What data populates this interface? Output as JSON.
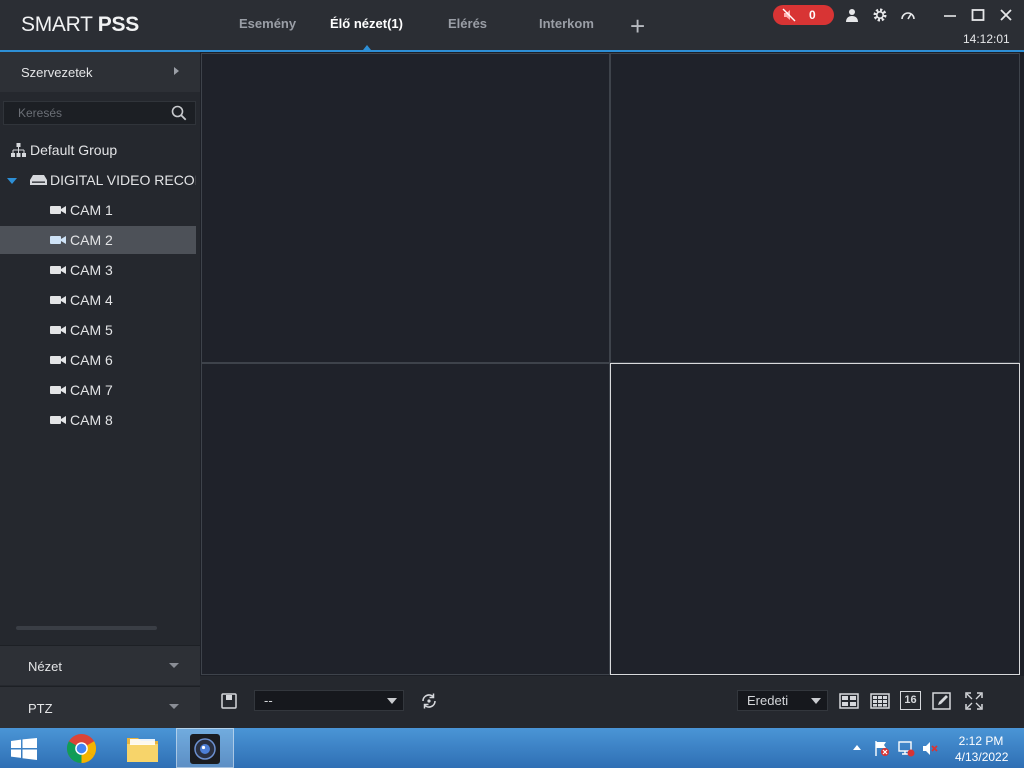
{
  "app": {
    "logo_light": "SMART ",
    "logo_bold": "PSS",
    "clock": "14:12:01"
  },
  "tabs": [
    {
      "label": "Esemény"
    },
    {
      "label": "Élő nézet(1)"
    },
    {
      "label": "Elérés"
    },
    {
      "label": "Interkom"
    }
  ],
  "alarm": {
    "count": "0"
  },
  "sidebar": {
    "org_label": "Szervezetek",
    "search_placeholder": "Keresés",
    "group": "Default Group",
    "device": "DIGITAL VIDEO RECORDER",
    "cameras": [
      "CAM 1",
      "CAM 2",
      "CAM 3",
      "CAM 4",
      "CAM 5",
      "CAM 6",
      "CAM 7",
      "CAM 8"
    ],
    "selected_camera": "CAM 2",
    "view_label": "Nézet",
    "ptz_label": "PTZ"
  },
  "toolbar": {
    "view_select": "--",
    "ratio_select": "Eredeti",
    "grid16_label": "16"
  },
  "taskbar": {
    "time": "2:12 PM",
    "date": "4/13/2022"
  },
  "colors": {
    "accent": "#2d8fd6",
    "alarm": "#d83434"
  }
}
